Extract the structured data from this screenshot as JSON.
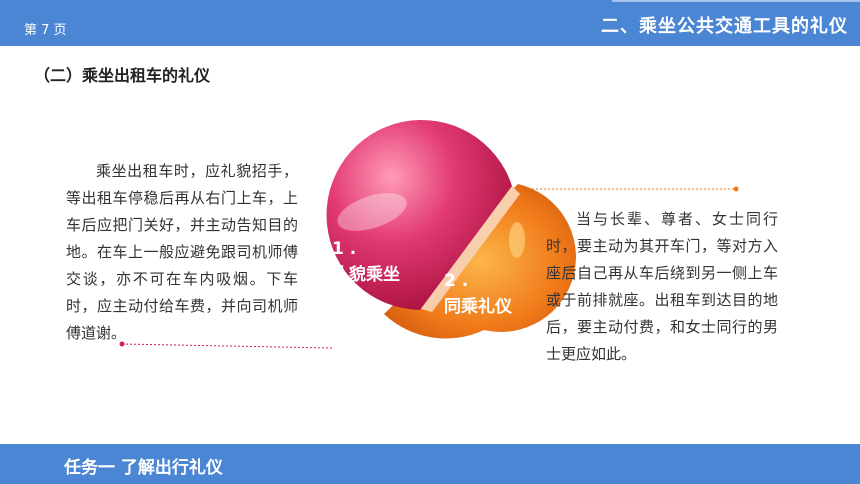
{
  "header": {
    "page_label": "第 7 页",
    "title": "二、乘坐公共交通工具的礼仪"
  },
  "section": {
    "title": "（二）乘坐出租车的礼仪"
  },
  "left_paragraph": "乘坐出租车时，应礼貌招手，等出租车停稳后再从右门上车，上车后应把门关好，并主动告知目的地。在车上一般应避免跟司机师傅交谈，亦不可在车内吸烟。下车时，应主动付给车费，并向司机师傅道谢。",
  "right_paragraph": "当与长辈、尊者、女士同行时，要主动为其开车门，等对方入座后自己再从车后绕到另一侧上车或于前排就座。出租车到达目的地后，要主动付费，和女士同行的男士更应如此。",
  "items": [
    {
      "number": "1 .",
      "label": "礼貌乘坐",
      "color": "#d81b5a"
    },
    {
      "number": "2 .",
      "label": "同乘礼仪",
      "color": "#f07a1a"
    }
  ],
  "footer": {
    "text": "任务一  了解出行礼仪"
  },
  "colors": {
    "brand": "#4a86d4",
    "item1": "#d81b5a",
    "item2": "#f07a1a"
  }
}
